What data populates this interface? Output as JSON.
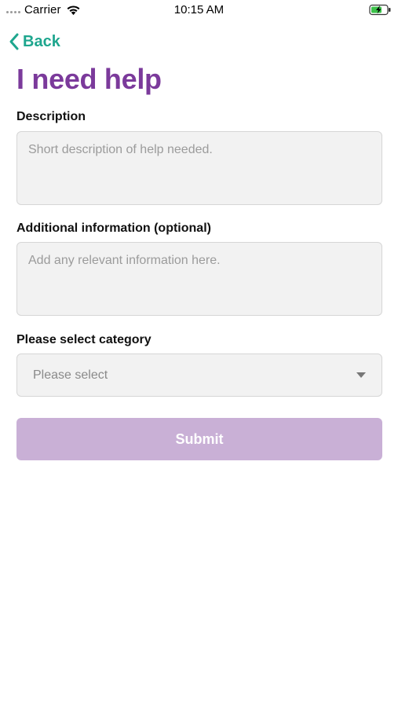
{
  "status_bar": {
    "carrier": "Carrier",
    "time": "10:15 AM"
  },
  "nav": {
    "back_label": "Back"
  },
  "page": {
    "title": "I need help"
  },
  "form": {
    "description": {
      "label": "Description",
      "placeholder": "Short description of help needed.",
      "value": ""
    },
    "additional_info": {
      "label": "Additional information (optional)",
      "placeholder": "Add any relevant information here.",
      "value": ""
    },
    "category": {
      "label": "Please select category",
      "selected": "Please select"
    },
    "submit_label": "Submit"
  },
  "colors": {
    "accent_teal": "#1ea68e",
    "title_purple": "#7b3a9b",
    "submit_disabled": "#c9b0d6",
    "field_bg": "#f2f2f2"
  },
  "icons": [
    "wifi-icon",
    "battery-charging-icon",
    "chevron-left-icon",
    "chevron-down-icon"
  ]
}
